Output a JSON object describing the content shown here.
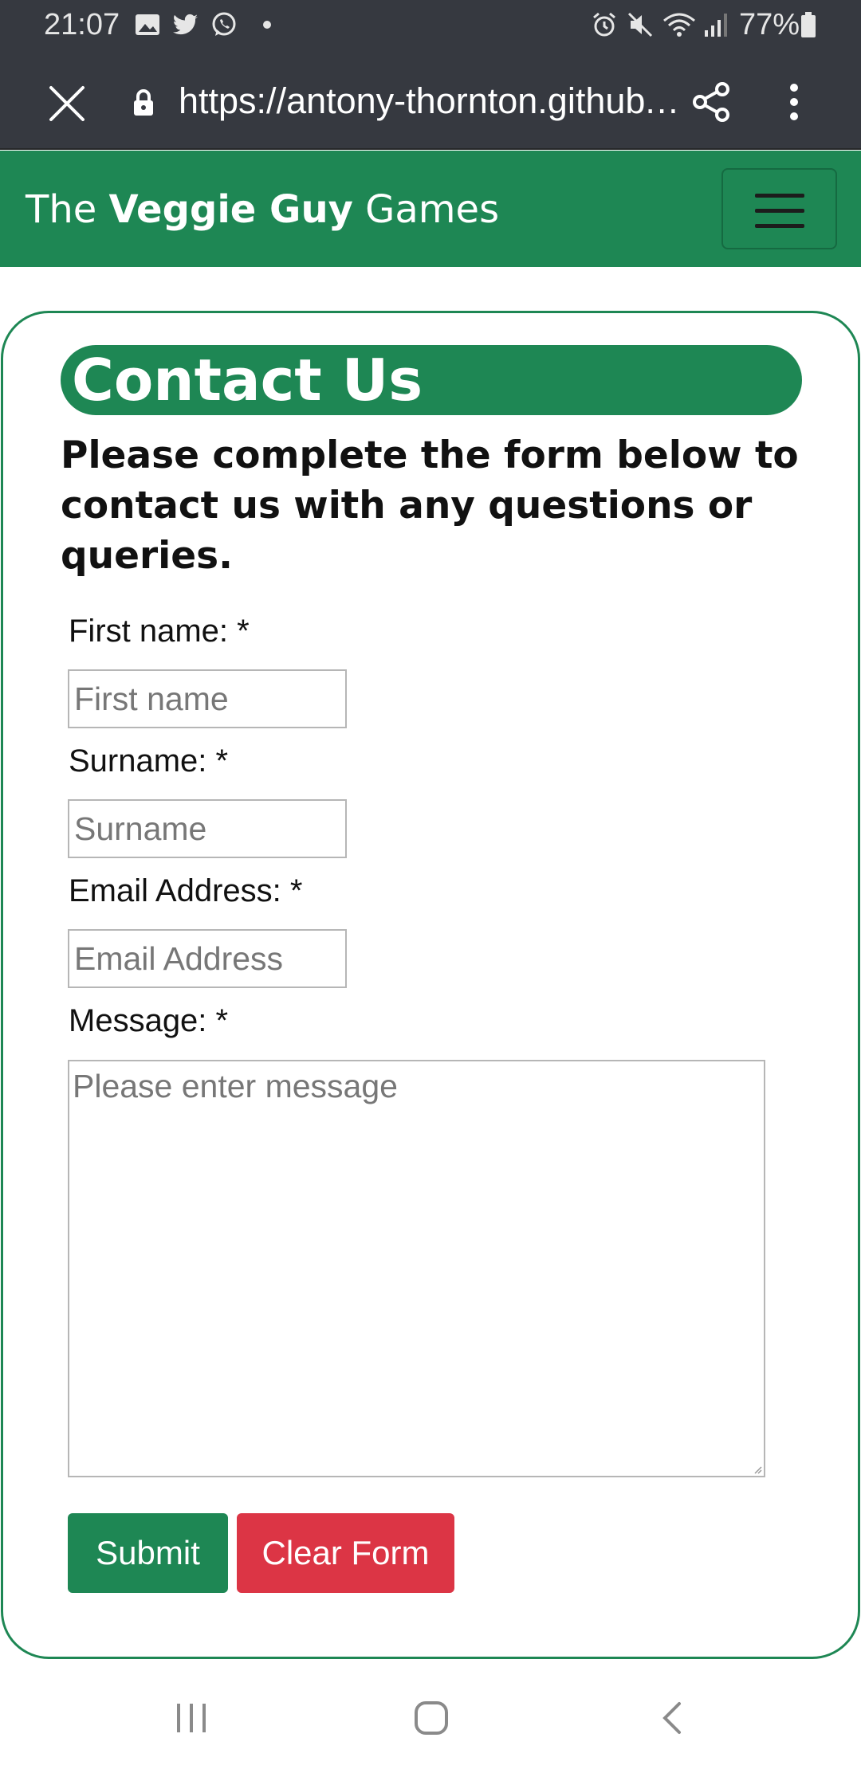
{
  "status_bar": {
    "time": "21:07",
    "battery": "77%",
    "left_icons": [
      "gallery-icon",
      "twitter-icon",
      "whatsapp-icon",
      "dot-icon"
    ],
    "right_icons": [
      "alarm-icon",
      "mute-icon",
      "wifi-icon",
      "signal-icon",
      "battery-icon"
    ]
  },
  "browser": {
    "url": "https://antony-thornton.github.…"
  },
  "navbar": {
    "brand_prefix": "The ",
    "brand_bold": "Veggie Guy",
    "brand_suffix": " Games"
  },
  "page": {
    "heading": "Contact Us",
    "intro": "Please complete the form below to contact us with any questions or queries."
  },
  "form": {
    "first_name_label": "First name: *",
    "first_name_placeholder": "First name",
    "surname_label": "Surname: *",
    "surname_placeholder": "Surname",
    "email_label": "Email Address: *",
    "email_placeholder": "Email Address",
    "message_label": "Message: *",
    "message_placeholder": "Please enter message",
    "submit_label": "Submit",
    "clear_label": "Clear Form"
  },
  "colors": {
    "brand_green": "#1e8754",
    "danger_red": "#dc3545",
    "system_bar": "#363940"
  }
}
